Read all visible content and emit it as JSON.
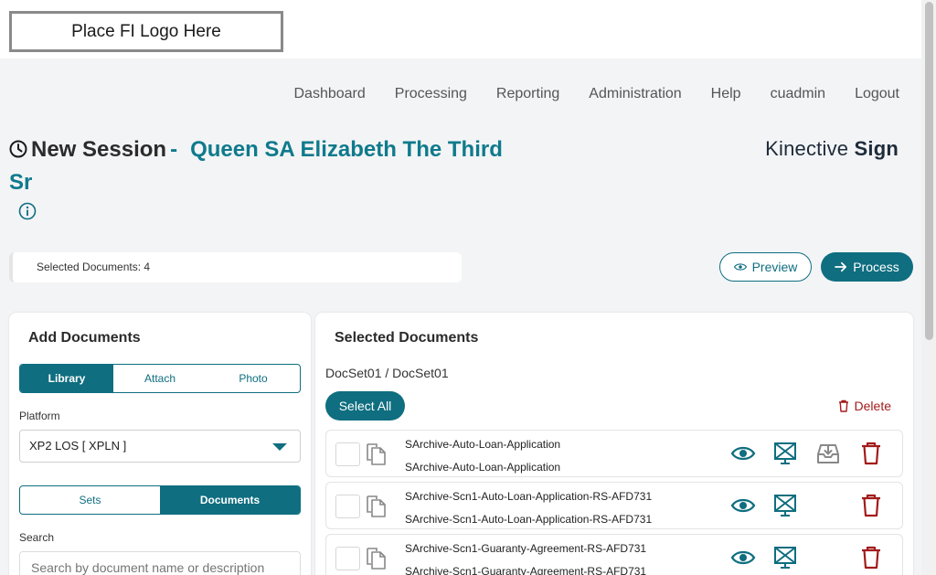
{
  "logo": {
    "text": "Place FI Logo Here"
  },
  "nav": [
    "Dashboard",
    "Processing",
    "Reporting",
    "Administration",
    "Help",
    "cuadmin",
    "Logout"
  ],
  "session": {
    "prefix": "New Session",
    "separator": "-",
    "name": "Queen SA Elizabeth The Third Sr"
  },
  "brand": {
    "light": "Kinective ",
    "bold": "Sign"
  },
  "selected_count": "Selected Documents: 4",
  "actions": {
    "preview": "Preview",
    "process": "Process"
  },
  "add_documents": {
    "title": "Add Documents",
    "source_tabs": [
      {
        "label": "Library",
        "active": true
      },
      {
        "label": "Attach",
        "active": false
      },
      {
        "label": "Photo",
        "active": false
      }
    ],
    "platform_label": "Platform",
    "platform_value": "XP2 LOS [ XPLN ]",
    "view_tabs": [
      {
        "label": "Sets",
        "active": false
      },
      {
        "label": "Documents",
        "active": true
      }
    ],
    "search_label": "Search",
    "search_placeholder": "Search by document name or description"
  },
  "selected_documents": {
    "title": "Selected Documents",
    "breadcrumb": "DocSet01 / DocSet01",
    "select_all": "Select All",
    "delete": "Delete",
    "rows": [
      {
        "name": "SArchive-Auto-Loan-Application",
        "description": "SArchive-Auto-Loan-Application",
        "icons": [
          "eye-icon",
          "sign-icon",
          "archive-icon",
          "trash-icon"
        ]
      },
      {
        "name": "SArchive-Scn1-Auto-Loan-Application-RS-AFD731",
        "description": "SArchive-Scn1-Auto-Loan-Application-RS-AFD731",
        "icons": [
          "eye-icon",
          "sign-icon",
          "trash-icon"
        ]
      },
      {
        "name": "SArchive-Scn1-Guaranty-Agreement-RS-AFD731",
        "description": "SArchive-Scn1-Guaranty-Agreement-RS-AFD731",
        "icons": [
          "eye-icon",
          "sign-icon",
          "trash-icon"
        ]
      }
    ]
  },
  "colors": {
    "accent": "#0f6e80",
    "danger": "#a31b1b",
    "background": "#f3f4f6"
  }
}
